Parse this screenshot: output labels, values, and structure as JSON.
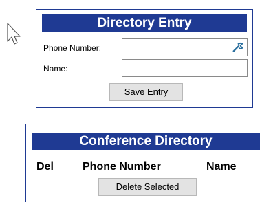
{
  "directory_entry": {
    "title": "Directory Entry",
    "phone_label": "Phone Number:",
    "phone_value": "",
    "name_label": "Name:",
    "name_value": "",
    "save_button": "Save Entry",
    "phone_action_icon": "wrench-icon"
  },
  "conference_directory": {
    "title": "Conference Directory",
    "columns": [
      "Del",
      "Phone Number",
      "Name"
    ],
    "rows": [],
    "delete_button": "Delete Selected"
  },
  "cursor_icon": "arrow-cursor-icon",
  "colors": {
    "header_bg": "#1f3a93",
    "header_text": "#ffffff",
    "button_bg": "#e3e3e3"
  }
}
